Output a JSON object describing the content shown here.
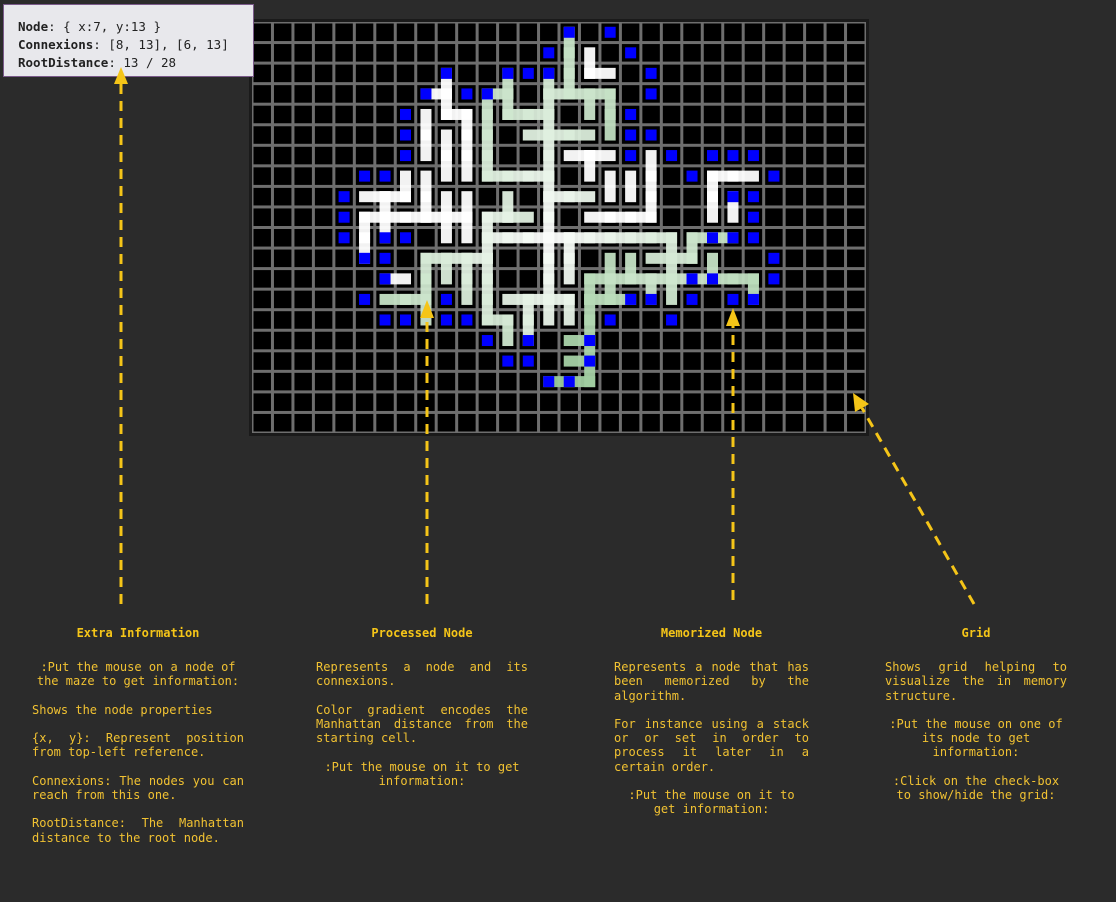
{
  "tooltip": {
    "node_label": "Node",
    "node_value": ": { x:7, y:13 }",
    "connexions_label": "Connexions",
    "connexions_value": ": [8, 13], [6, 13]",
    "root_distance_label": "RootDistance",
    "root_distance_value": ": 13 / 28"
  },
  "colors": {
    "background": "#2b2b2b",
    "grid_line": "#6e6e6e",
    "cell": "#000000",
    "memorized": "#0000ff",
    "processed_near": "#ffffff",
    "processed_far": "#6bb36b",
    "annotation": "#f5c518"
  },
  "maze": {
    "cols": 30,
    "rows": 20,
    "root": [
      14,
      10
    ],
    "max_root_distance": 28,
    "segments": [
      [
        [
          14,
          10
        ],
        [
          14,
          4
        ]
      ],
      [
        [
          14,
          10
        ],
        [
          20,
          10
        ]
      ],
      [
        [
          14,
          10
        ],
        [
          14,
          14
        ]
      ],
      [
        [
          14,
          10
        ],
        [
          11,
          10
        ]
      ],
      [
        [
          14,
          4
        ],
        [
          14,
          2
        ]
      ],
      [
        [
          14,
          3
        ],
        [
          17,
          3
        ]
      ],
      [
        [
          15,
          3
        ],
        [
          15,
          0
        ]
      ],
      [
        [
          16,
          1
        ],
        [
          16,
          2
        ]
      ],
      [
        [
          16,
          2
        ],
        [
          17,
          2
        ]
      ],
      [
        [
          17,
          3
        ],
        [
          17,
          5
        ]
      ],
      [
        [
          16,
          3
        ],
        [
          16,
          4
        ]
      ],
      [
        [
          14,
          4
        ],
        [
          12,
          4
        ]
      ],
      [
        [
          12,
          4
        ],
        [
          12,
          2
        ]
      ],
      [
        [
          12,
          3
        ],
        [
          11,
          3
        ]
      ],
      [
        [
          13,
          5
        ],
        [
          16,
          5
        ]
      ],
      [
        [
          15,
          6
        ],
        [
          17,
          6
        ]
      ],
      [
        [
          16,
          6
        ],
        [
          16,
          7
        ]
      ],
      [
        [
          14,
          7
        ],
        [
          11,
          7
        ]
      ],
      [
        [
          11,
          7
        ],
        [
          11,
          3
        ]
      ],
      [
        [
          10,
          4
        ],
        [
          10,
          7
        ]
      ],
      [
        [
          10,
          4
        ],
        [
          9,
          4
        ]
      ],
      [
        [
          9,
          4
        ],
        [
          9,
          2
        ]
      ],
      [
        [
          9,
          3
        ],
        [
          8,
          3
        ]
      ],
      [
        [
          8,
          4
        ],
        [
          8,
          6
        ]
      ],
      [
        [
          9,
          5
        ],
        [
          9,
          7
        ]
      ],
      [
        [
          8,
          7
        ],
        [
          8,
          9
        ]
      ],
      [
        [
          14,
          8
        ],
        [
          16,
          8
        ]
      ],
      [
        [
          12,
          8
        ],
        [
          12,
          9
        ]
      ],
      [
        [
          13,
          9
        ],
        [
          11,
          9
        ]
      ],
      [
        [
          11,
          9
        ],
        [
          11,
          14
        ]
      ],
      [
        [
          10,
          8
        ],
        [
          10,
          10
        ]
      ],
      [
        [
          10,
          9
        ],
        [
          7,
          9
        ]
      ],
      [
        [
          7,
          9
        ],
        [
          5,
          9
        ]
      ],
      [
        [
          5,
          9
        ],
        [
          5,
          11
        ]
      ],
      [
        [
          6,
          8
        ],
        [
          6,
          10
        ]
      ],
      [
        [
          5,
          8
        ],
        [
          7,
          8
        ]
      ],
      [
        [
          7,
          7
        ],
        [
          7,
          8
        ]
      ],
      [
        [
          9,
          8
        ],
        [
          9,
          10
        ]
      ],
      [
        [
          15,
          10
        ],
        [
          15,
          12
        ]
      ],
      [
        [
          16,
          9
        ],
        [
          19,
          9
        ]
      ],
      [
        [
          19,
          9
        ],
        [
          19,
          6
        ]
      ],
      [
        [
          18,
          7
        ],
        [
          18,
          8
        ]
      ],
      [
        [
          17,
          7
        ],
        [
          17,
          8
        ]
      ],
      [
        [
          20,
          10
        ],
        [
          20,
          12
        ]
      ],
      [
        [
          17,
          11
        ],
        [
          17,
          13
        ]
      ],
      [
        [
          18,
          11
        ],
        [
          18,
          12
        ]
      ],
      [
        [
          19,
          11
        ],
        [
          21,
          11
        ]
      ],
      [
        [
          21,
          11
        ],
        [
          21,
          10
        ]
      ],
      [
        [
          21,
          10
        ],
        [
          23,
          10
        ]
      ],
      [
        [
          22,
          9
        ],
        [
          22,
          7
        ]
      ],
      [
        [
          22,
          7
        ],
        [
          24,
          7
        ]
      ],
      [
        [
          23,
          9
        ],
        [
          23,
          8
        ]
      ],
      [
        [
          16,
          12
        ],
        [
          24,
          12
        ]
      ],
      [
        [
          24,
          12
        ],
        [
          24,
          13
        ]
      ],
      [
        [
          22,
          11
        ],
        [
          22,
          12
        ]
      ],
      [
        [
          20,
          12
        ],
        [
          20,
          13
        ]
      ],
      [
        [
          19,
          13
        ],
        [
          19,
          12
        ]
      ],
      [
        [
          16,
          13
        ],
        [
          18,
          13
        ]
      ],
      [
        [
          16,
          12
        ],
        [
          16,
          17
        ]
      ],
      [
        [
          15,
          15
        ],
        [
          16,
          15
        ]
      ],
      [
        [
          15,
          16
        ],
        [
          16,
          16
        ]
      ],
      [
        [
          14,
          17
        ],
        [
          16,
          17
        ]
      ],
      [
        [
          15,
          13
        ],
        [
          15,
          14
        ]
      ],
      [
        [
          12,
          13
        ],
        [
          15,
          13
        ]
      ],
      [
        [
          13,
          13
        ],
        [
          13,
          15
        ]
      ],
      [
        [
          12,
          14
        ],
        [
          12,
          15
        ]
      ],
      [
        [
          11,
          14
        ],
        [
          12,
          14
        ]
      ],
      [
        [
          11,
          11
        ],
        [
          8,
          11
        ]
      ],
      [
        [
          8,
          11
        ],
        [
          8,
          14
        ]
      ],
      [
        [
          9,
          11
        ],
        [
          9,
          12
        ]
      ],
      [
        [
          10,
          11
        ],
        [
          10,
          12
        ]
      ],
      [
        [
          7,
          12
        ],
        [
          6,
          12
        ]
      ],
      [
        [
          6,
          13
        ],
        [
          8,
          13
        ]
      ],
      [
        [
          10,
          13
        ],
        [
          10,
          12
        ]
      ]
    ],
    "memorized": [
      [
        15,
        0
      ],
      [
        17,
        0
      ],
      [
        14,
        1
      ],
      [
        18,
        1
      ],
      [
        9,
        2
      ],
      [
        12,
        2
      ],
      [
        13,
        2
      ],
      [
        14,
        2
      ],
      [
        19,
        2
      ],
      [
        8,
        3
      ],
      [
        10,
        3
      ],
      [
        11,
        3
      ],
      [
        19,
        3
      ],
      [
        7,
        4
      ],
      [
        18,
        4
      ],
      [
        7,
        5
      ],
      [
        18,
        5
      ],
      [
        19,
        5
      ],
      [
        7,
        6
      ],
      [
        18,
        6
      ],
      [
        20,
        6
      ],
      [
        22,
        6
      ],
      [
        23,
        6
      ],
      [
        24,
        6
      ],
      [
        5,
        7
      ],
      [
        6,
        7
      ],
      [
        21,
        7
      ],
      [
        25,
        7
      ],
      [
        4,
        8
      ],
      [
        23,
        8
      ],
      [
        24,
        8
      ],
      [
        4,
        9
      ],
      [
        24,
        9
      ],
      [
        4,
        10
      ],
      [
        6,
        10
      ],
      [
        7,
        10
      ],
      [
        22,
        10
      ],
      [
        23,
        10
      ],
      [
        24,
        10
      ],
      [
        5,
        11
      ],
      [
        6,
        11
      ],
      [
        25,
        11
      ],
      [
        6,
        12
      ],
      [
        21,
        12
      ],
      [
        22,
        12
      ],
      [
        25,
        12
      ],
      [
        5,
        13
      ],
      [
        9,
        13
      ],
      [
        18,
        13
      ],
      [
        19,
        13
      ],
      [
        21,
        13
      ],
      [
        23,
        13
      ],
      [
        24,
        13
      ],
      [
        6,
        14
      ],
      [
        7,
        14
      ],
      [
        9,
        14
      ],
      [
        10,
        14
      ],
      [
        17,
        14
      ],
      [
        20,
        14
      ],
      [
        11,
        15
      ],
      [
        13,
        15
      ],
      [
        16,
        15
      ],
      [
        12,
        16
      ],
      [
        13,
        16
      ],
      [
        16,
        16
      ],
      [
        14,
        17
      ],
      [
        15,
        17
      ]
    ]
  },
  "panels": [
    {
      "title": "Extra Information",
      "paragraphs": [
        {
          "text": ":Put the mouse on a node of the maze to get information:",
          "center": true
        },
        {
          "text": "Shows the node properties",
          "center": false
        },
        {
          "text": "{x, y}: Represent position from top-left reference.",
          "center": false
        },
        {
          "text": "Connexions: The nodes you can reach from this one.",
          "center": false
        },
        {
          "text": "RootDistance: The Manhattan distance to the root node.",
          "center": false
        }
      ]
    },
    {
      "title": "Processed Node",
      "paragraphs": [
        {
          "text": "Represents a node and its connexions.",
          "center": false
        },
        {
          "text": "Color gradient encodes the Manhattan distance from the starting cell.",
          "center": false
        },
        {
          "text": ":Put the mouse on it to get information:",
          "center": true
        }
      ]
    },
    {
      "title": "Memorized Node",
      "paragraphs": [
        {
          "text": "Represents a node that has been memorized by the algorithm.",
          "center": false
        },
        {
          "text": "For instance using a stack or or set in order to process it later in a certain order.",
          "center": false
        },
        {
          "text": ":Put the mouse on it to get information:",
          "center": true
        }
      ]
    },
    {
      "title": "Grid",
      "paragraphs": [
        {
          "text": "Shows grid helping to visualize the in memory structure.",
          "center": false
        },
        {
          "text": ":Put the mouse on one of its node to get information:",
          "center": true
        },
        {
          "text": ":Click on the check-box to show/hide the grid:",
          "center": true
        }
      ]
    }
  ]
}
